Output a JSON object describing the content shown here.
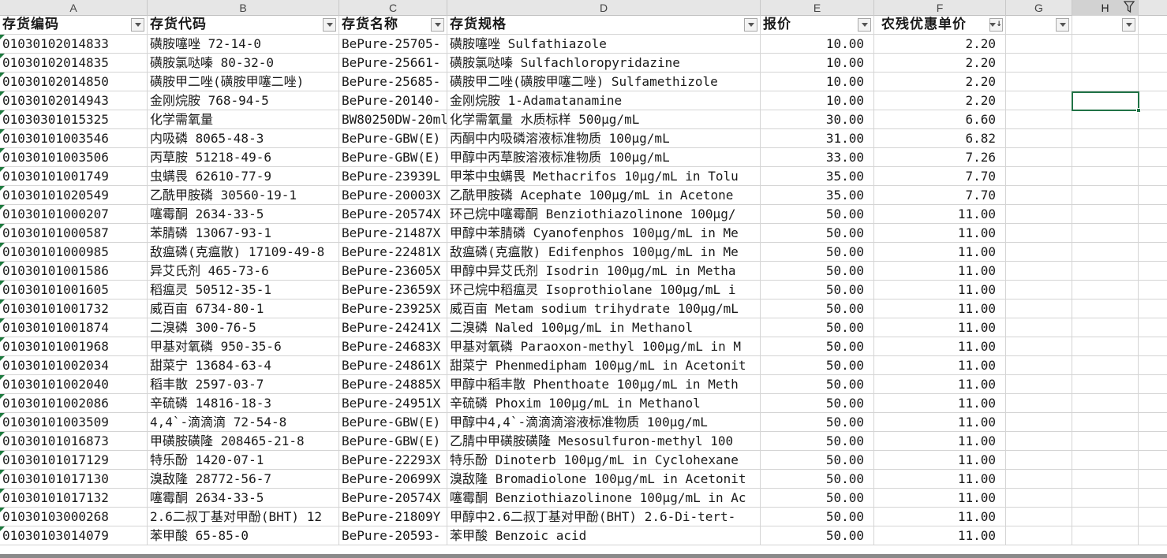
{
  "columns": [
    "A",
    "B",
    "C",
    "D",
    "E",
    "F",
    "G",
    "H"
  ],
  "headers": [
    "存货编码",
    "存货代码",
    "存货名称",
    "存货规格",
    "报价",
    "农残优惠单价",
    "",
    ""
  ],
  "rows": [
    [
      "01030102014833",
      "磺胺噻唑 72-14-0",
      "BePure-25705-",
      "磺胺噻唑 Sulfathiazole",
      "10.00",
      "2.20"
    ],
    [
      "01030102014835",
      "磺胺氯哒嗪 80-32-0",
      "BePure-25661-",
      "磺胺氯哒嗪 Sulfachloropyridazine",
      "10.00",
      "2.20"
    ],
    [
      "01030102014850",
      "磺胺甲二唑(磺胺甲噻二唑)",
      "BePure-25685-",
      "磺胺甲二唑(磺胺甲噻二唑) Sulfamethizole",
      "10.00",
      "2.20"
    ],
    [
      "01030102014943",
      "金刚烷胺 768-94-5",
      "BePure-20140-",
      "金刚烷胺 1-Adamatanamine",
      "10.00",
      "2.20"
    ],
    [
      "01030301015325",
      "化学需氧量",
      "BW80250DW-20ml",
      "化学需氧量 水质标样 500μg/mL",
      "30.00",
      "6.60"
    ],
    [
      "01030101003546",
      "内吸磷 8065-48-3",
      "BePure-GBW(E)",
      "丙酮中内吸磷溶液标准物质 100μg/mL",
      "31.00",
      "6.82"
    ],
    [
      "01030101003506",
      "丙草胺 51218-49-6",
      "BePure-GBW(E)",
      "甲醇中丙草胺溶液标准物质 100μg/mL",
      "33.00",
      "7.26"
    ],
    [
      "01030101001749",
      "虫螨畏 62610-77-9",
      "BePure-23939L",
      "甲苯中虫螨畏 Methacrifos 10μg/mL in Tolu",
      "35.00",
      "7.70"
    ],
    [
      "01030101020549",
      "乙酰甲胺磷 30560-19-1",
      "BePure-20003X",
      "乙酰甲胺磷 Acephate 100μg/mL in Acetone",
      "35.00",
      "7.70"
    ],
    [
      "01030101000207",
      "噻霉酮 2634-33-5",
      "BePure-20574X",
      "环己烷中噻霉酮 Benziothiazolinone 100μg/",
      "50.00",
      "11.00"
    ],
    [
      "01030101000587",
      "苯腈磷 13067-93-1",
      "BePure-21487X",
      "甲醇中苯腈磷 Cyanofenphos 100μg/mL in Me",
      "50.00",
      "11.00"
    ],
    [
      "01030101000985",
      "敌瘟磷(克瘟散) 17109-49-8",
      "BePure-22481X",
      "敌瘟磷(克瘟散) Edifenphos 100μg/mL in Me",
      "50.00",
      "11.00"
    ],
    [
      "01030101001586",
      "异艾氏剂 465-73-6",
      "BePure-23605X",
      "甲醇中异艾氏剂 Isodrin 100μg/mL in Metha",
      "50.00",
      "11.00"
    ],
    [
      "01030101001605",
      "稻瘟灵 50512-35-1",
      "BePure-23659X",
      "环己烷中稻瘟灵 Isoprothiolane 100μg/mL i",
      "50.00",
      "11.00"
    ],
    [
      "01030101001732",
      "威百亩  6734-80-1",
      "BePure-23925X",
      "威百亩 Metam sodium trihydrate 100μg/mL",
      "50.00",
      "11.00"
    ],
    [
      "01030101001874",
      "二溴磷 300-76-5",
      "BePure-24241X",
      "二溴磷 Naled 100μg/mL in Methanol",
      "50.00",
      "11.00"
    ],
    [
      "01030101001968",
      "甲基对氧磷  950-35-6",
      "BePure-24683X",
      "甲基对氧磷 Paraoxon-methyl 100μg/mL in M",
      "50.00",
      "11.00"
    ],
    [
      "01030101002034",
      "甜菜宁 13684-63-4",
      "BePure-24861X",
      "甜菜宁 Phenmedipham 100μg/mL in Acetonit",
      "50.00",
      "11.00"
    ],
    [
      "01030101002040",
      "稻丰散 2597-03-7",
      "BePure-24885X",
      "甲醇中稻丰散 Phenthoate 100μg/mL in Meth",
      "50.00",
      "11.00"
    ],
    [
      "01030101002086",
      "辛硫磷 14816-18-3",
      "BePure-24951X",
      "辛硫磷 Phoxim 100μg/mL in Methanol",
      "50.00",
      "11.00"
    ],
    [
      "01030101003509",
      "4,4`-滴滴滴 72-54-8",
      "BePure-GBW(E)",
      "甲醇中4,4`-滴滴滴溶液标准物质 100μg/mL",
      "50.00",
      "11.00"
    ],
    [
      "01030101016873",
      "甲磺胺磺隆  208465-21-8",
      "BePure-GBW(E)",
      "乙腈中甲磺胺磺隆 Mesosulfuron-methyl 100",
      "50.00",
      "11.00"
    ],
    [
      "01030101017129",
      "特乐酚 1420-07-1",
      "BePure-22293X",
      "特乐酚 Dinoterb 100μg/mL in Cyclohexane",
      "50.00",
      "11.00"
    ],
    [
      "01030101017130",
      "溴敌隆 28772-56-7",
      "BePure-20699X",
      "溴敌隆 Bromadiolone 100μg/mL in Acetonit",
      "50.00",
      "11.00"
    ],
    [
      "01030101017132",
      "噻霉酮 2634-33-5",
      "BePure-20574X",
      "噻霉酮 Benziothiazolinone 100μg/mL in Ac",
      "50.00",
      "11.00"
    ],
    [
      "01030103000268",
      "2.6二叔丁基对甲酚(BHT) 12",
      "BePure-21809Y",
      "甲醇中2.6二叔丁基对甲酚(BHT) 2.6-Di-tert-",
      "50.00",
      "11.00"
    ],
    [
      "01030103014079",
      "苯甲酸 65-85-0",
      "BePure-20593-",
      "苯甲酸 Benzoic acid",
      "50.00",
      "11.00"
    ]
  ],
  "icons": {
    "filter": "dropdown-triangle",
    "sort": "sort-descending-arrow",
    "filter_active": "funnel"
  },
  "colors": {
    "accent": "#217346",
    "error_marker": "#1d7a3e"
  }
}
